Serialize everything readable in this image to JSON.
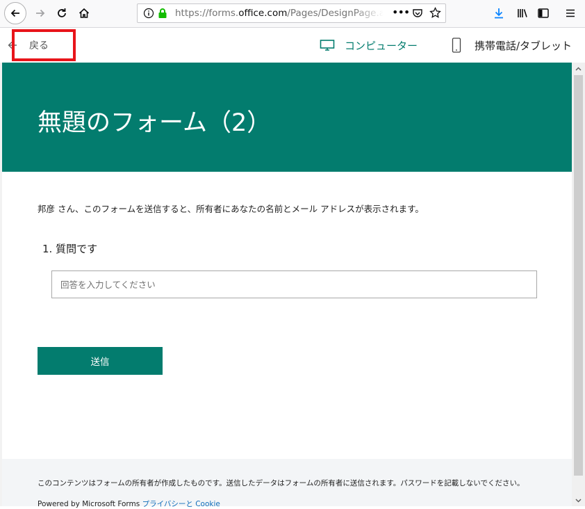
{
  "browser": {
    "url_prefix": "https://forms.",
    "url_domain": "office.com",
    "url_rest": "/Pages/DesignPage.aspx"
  },
  "header": {
    "back_label": "戻る",
    "computer_label": "コンピューター",
    "mobile_label": "携帯電話/タブレット"
  },
  "form": {
    "title": "無題のフォーム（2）",
    "notice": "邦彦 さん、このフォームを送信すると、所有者にあなたの名前とメール アドレスが表示されます。",
    "question_label": "1. 質問です",
    "answer_placeholder": "回答を入力してください",
    "submit_label": "送信"
  },
  "footer": {
    "text": "このコンテンツはフォームの所有者が作成したものです。送信したデータはフォームの所有者に送信されます。パスワードを記載しないでください。",
    "powered": "Powered by Microsoft Forms",
    "links": "プライバシーと Cookie"
  },
  "colors": {
    "accent": "#037c6e",
    "highlight_box": "#e8141a",
    "link": "#0f6dba"
  }
}
